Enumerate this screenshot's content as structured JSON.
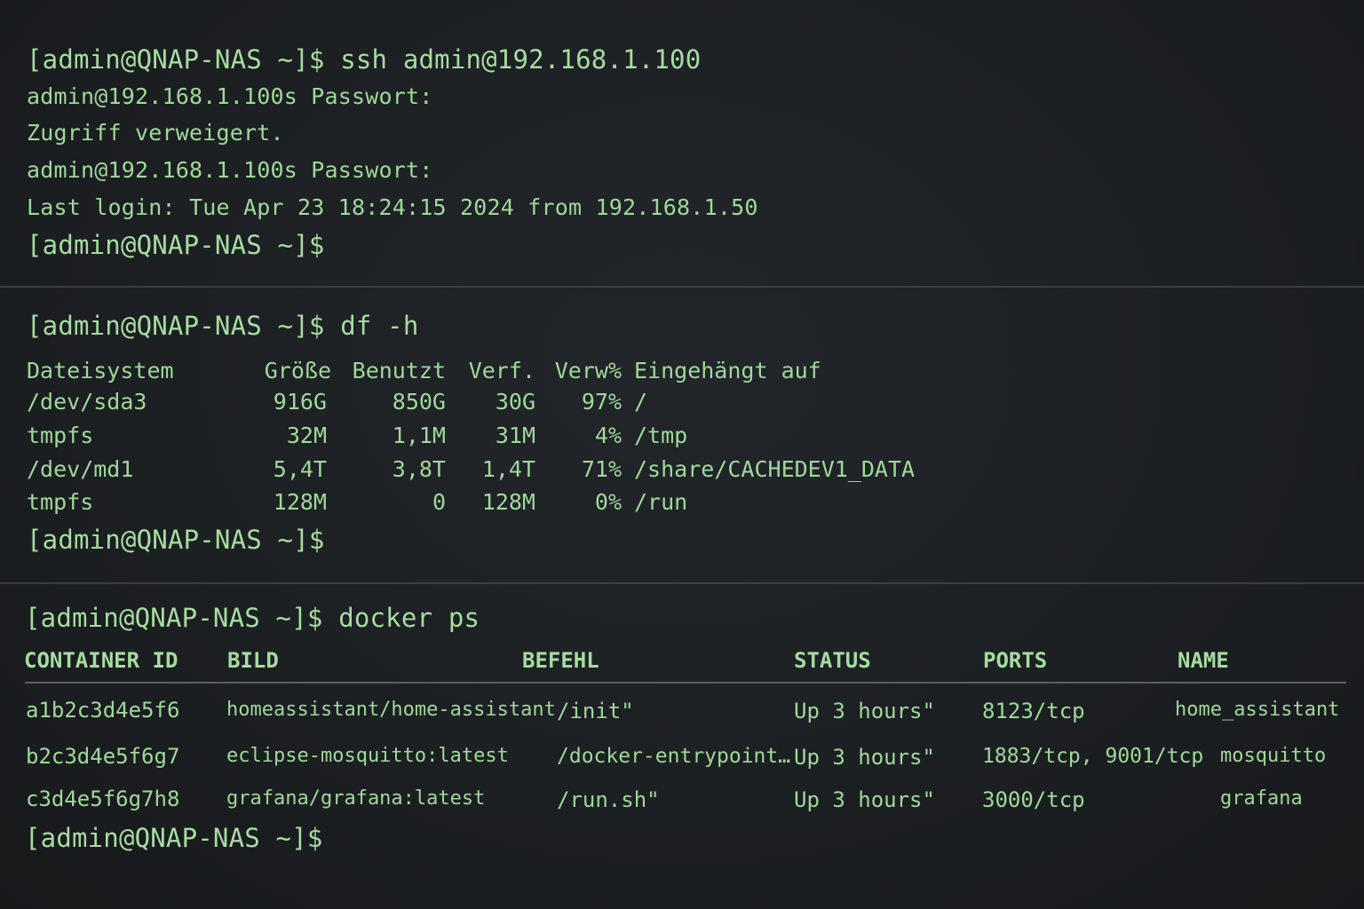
{
  "prompt": "[admin@QNAP-NAS ~]$",
  "session1": {
    "command": "ssh admin@192.168.1.100",
    "lines": [
      "admin@192.168.1.100s Passwort:",
      "Zugriff verweigert.",
      "admin@192.168.1.100s Passwort:",
      "Last login: Tue Apr 23 18:24:15 2024 from 192.168.1.50"
    ]
  },
  "session2": {
    "command": "df -h",
    "headers": [
      "Dateisystem",
      "Größe",
      "Benutzt",
      "Verf.",
      "Verw%",
      "Eingehängt auf"
    ],
    "rows": [
      [
        "/dev/sda3",
        "916G",
        "850G",
        "30G",
        "97%",
        "/"
      ],
      [
        "tmpfs",
        "32M",
        "1,1M",
        "31M",
        "4%",
        "/tmp"
      ],
      [
        "/dev/md1",
        "5,4T",
        "3,8T",
        "1,4T",
        "71%",
        "/share/CACHEDEV1_DATA"
      ],
      [
        "tmpfs",
        "128M",
        "0",
        "128M",
        "0%",
        "/run"
      ]
    ]
  },
  "session3": {
    "command": "docker ps",
    "headers": [
      "CONTAINER ID",
      "BILD",
      "BEFEHL",
      "STATUS",
      "PORTS",
      "NAME"
    ],
    "rows": [
      [
        "a1b2c3d4e5f6",
        "homeassistant/home-assistant",
        "/init\"",
        "Up 3 hours\"",
        "8123/tcp",
        "home_assistant"
      ],
      [
        "b2c3d4e5f6g7",
        "eclipse-mosquitto:latest",
        "/docker-entrypoint…",
        "Up 3 hours\"",
        "1883/tcp, 9001/tcp",
        "mosquitto"
      ],
      [
        "c3d4e5f6g7h8",
        "grafana/grafana:latest",
        "/run.sh\"",
        "Up 3 hours\"",
        "3000/tcp",
        "grafana"
      ]
    ]
  },
  "colors": {
    "background": "#1b1e21",
    "text": "#9fd89a"
  }
}
